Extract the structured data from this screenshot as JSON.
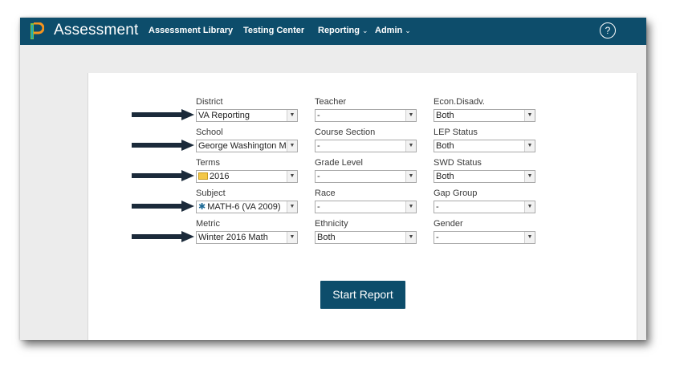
{
  "app": {
    "title": "Assessment"
  },
  "nav": {
    "items": [
      {
        "label": "Assessment Library"
      },
      {
        "label": "Testing Center"
      },
      {
        "label": "Reporting",
        "chevron": "⌄"
      },
      {
        "label": "Admin",
        "chevron": "⌄"
      }
    ],
    "help_icon": "?"
  },
  "filters": {
    "district": {
      "label": "District",
      "value": "VA Reporting"
    },
    "school": {
      "label": "School",
      "value": "George Washington M"
    },
    "terms": {
      "label": "Terms",
      "value": "2016",
      "icon": "folder-icon"
    },
    "subject": {
      "label": "Subject",
      "value": "MATH-6 (VA 2009)",
      "icon": "gear-icon"
    },
    "metric": {
      "label": "Metric",
      "value": "Winter 2016 Math"
    },
    "teacher": {
      "label": "Teacher",
      "value": "-"
    },
    "course_section": {
      "label": "Course Section",
      "value": "-"
    },
    "grade_level": {
      "label": "Grade Level",
      "value": "-"
    },
    "race": {
      "label": "Race",
      "value": "-"
    },
    "ethnicity": {
      "label": "Ethnicity",
      "value": "Both"
    },
    "econ_disadv": {
      "label": "Econ.Disadv.",
      "value": "Both"
    },
    "lep_status": {
      "label": "LEP Status",
      "value": "Both"
    },
    "swd_status": {
      "label": "SWD Status",
      "value": "Both"
    },
    "gap_group": {
      "label": "Gap Group",
      "value": "-"
    },
    "gender": {
      "label": "Gender",
      "value": "-"
    }
  },
  "actions": {
    "start_report": "Start Report"
  },
  "colors": {
    "brand": "#0d4d6b",
    "arrow": "#1b2a3a"
  }
}
